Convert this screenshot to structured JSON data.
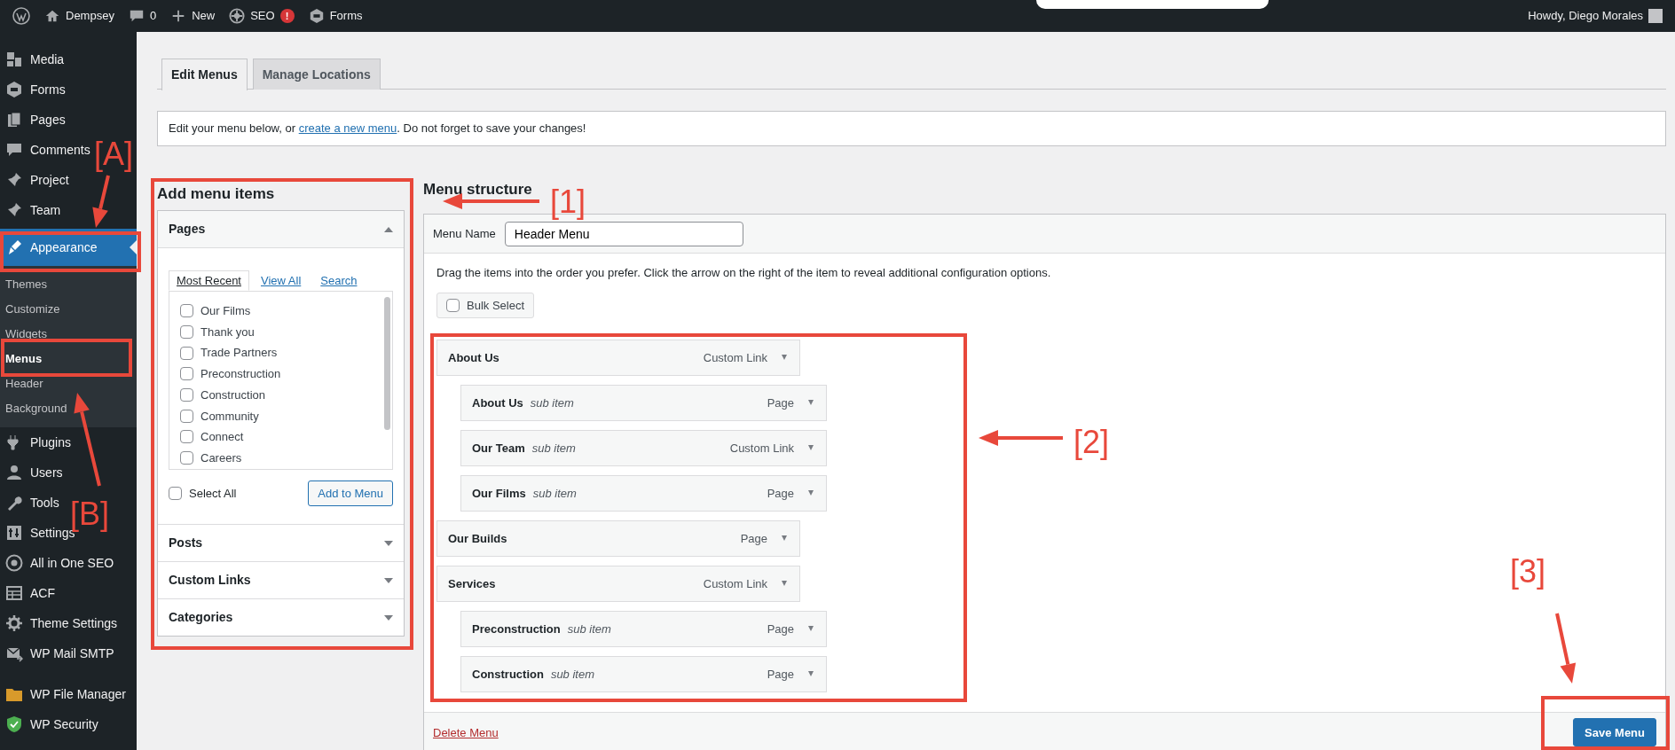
{
  "admin_bar": {
    "items": [
      {
        "kind": "logo"
      },
      {
        "kind": "site",
        "label": "Dempsey"
      },
      {
        "kind": "comments",
        "label": "0"
      },
      {
        "kind": "new",
        "label": "New"
      },
      {
        "kind": "seo",
        "label": "SEO",
        "badge": "!"
      },
      {
        "kind": "forms",
        "label": "Forms"
      }
    ],
    "greeting": "Howdy, Diego Morales"
  },
  "sidebar": {
    "items": [
      {
        "label": "Media",
        "selected": false
      },
      {
        "label": "Forms",
        "selected": false
      },
      {
        "label": "Pages",
        "selected": false
      },
      {
        "label": "Comments",
        "selected": false
      },
      {
        "label": "Project",
        "selected": false
      },
      {
        "label": "Team",
        "selected": false
      },
      {
        "label": "Appearance",
        "selected": true,
        "expanded": true,
        "children": [
          {
            "label": "Themes",
            "selected": false
          },
          {
            "label": "Customize",
            "selected": false
          },
          {
            "label": "Widgets",
            "selected": false
          },
          {
            "label": "Menus",
            "selected": true
          },
          {
            "label": "Header",
            "selected": false
          },
          {
            "label": "Background",
            "selected": false
          }
        ]
      },
      {
        "label": "Plugins",
        "selected": false
      },
      {
        "label": "Users",
        "selected": false
      },
      {
        "label": "Tools",
        "selected": false
      },
      {
        "label": "Settings",
        "selected": false
      },
      {
        "label": "All in One SEO",
        "selected": false
      },
      {
        "label": "ACF",
        "selected": false
      },
      {
        "label": "Theme Settings",
        "selected": false
      },
      {
        "label": "WP Mail SMTP",
        "selected": false
      },
      {
        "label": "WP File Manager",
        "selected": false
      },
      {
        "label": "WP Security",
        "selected": false
      }
    ]
  },
  "tabs": [
    {
      "label": "Edit Menus",
      "selected": true
    },
    {
      "label": "Manage Locations",
      "selected": false
    }
  ],
  "notice": {
    "before": "Edit your menu below, or ",
    "link": "create a new menu",
    "after": ". Do not forget to save your changes!"
  },
  "add_items": {
    "title": "Add menu items",
    "sections": [
      {
        "title": "Pages",
        "expanded": true,
        "tabs": [
          {
            "label": "Most Recent",
            "selected": true
          },
          {
            "label": "View All",
            "selected": false
          },
          {
            "label": "Search",
            "selected": false
          }
        ],
        "pages": [
          {
            "label": "Our Films",
            "checked": false
          },
          {
            "label": "Thank you",
            "checked": false
          },
          {
            "label": "Trade Partners",
            "checked": false
          },
          {
            "label": "Preconstruction",
            "checked": false
          },
          {
            "label": "Construction",
            "checked": false
          },
          {
            "label": "Community",
            "checked": false
          },
          {
            "label": "Connect",
            "checked": false
          },
          {
            "label": "Careers",
            "checked": false
          }
        ],
        "select_all": {
          "label": "Select All",
          "checked": false
        },
        "button": "Add to Menu"
      },
      {
        "title": "Posts",
        "expanded": false
      },
      {
        "title": "Custom Links",
        "expanded": false
      },
      {
        "title": "Categories",
        "expanded": false
      }
    ]
  },
  "menu_structure": {
    "title": "Menu structure",
    "name_label": "Menu Name",
    "name_value": "Header Menu",
    "instructions": "Drag the items into the order you prefer. Click the arrow on the right of the item to reveal additional configuration options.",
    "bulk_select": {
      "label": "Bulk Select",
      "checked": false
    },
    "items": [
      {
        "label": "About Us",
        "type": "Custom Link",
        "children": [
          {
            "label": "About Us",
            "note": "sub item",
            "type": "Page"
          },
          {
            "label": "Our Team",
            "note": "sub item",
            "type": "Custom Link"
          },
          {
            "label": "Our Films",
            "note": "sub item",
            "type": "Page"
          }
        ]
      },
      {
        "label": "Our Builds",
        "type": "Page"
      },
      {
        "label": "Services",
        "type": "Custom Link",
        "children": [
          {
            "label": "Preconstruction",
            "note": "sub item",
            "type": "Page"
          },
          {
            "label": "Construction",
            "note": "sub item",
            "type": "Page"
          }
        ]
      }
    ],
    "delete": "Delete Menu",
    "save": "Save Menu"
  },
  "annotations": [
    {
      "label": "[A]"
    },
    {
      "label": "[B]"
    },
    {
      "label": "[1]"
    },
    {
      "label": "[2]"
    },
    {
      "label": "[3]"
    }
  ]
}
